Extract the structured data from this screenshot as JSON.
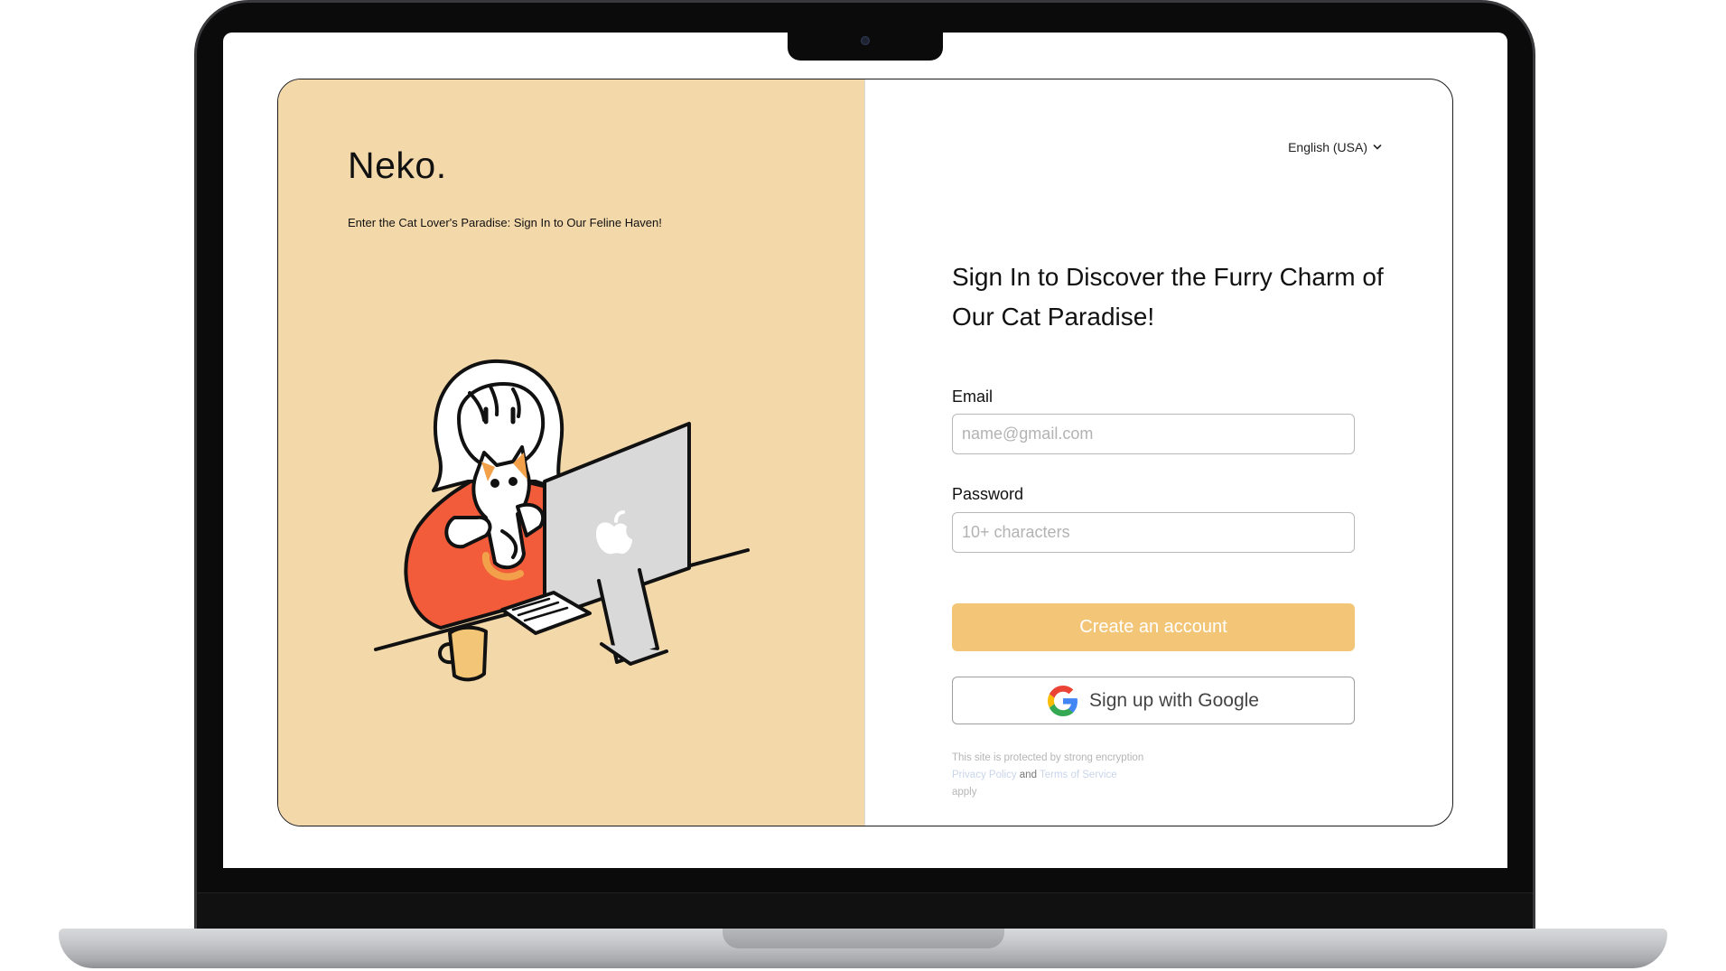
{
  "app": {
    "brand": "Neko.",
    "tagline": "Enter the Cat Lover's Paradise: Sign In to Our Feline Haven!",
    "language_selector": "English (USA)"
  },
  "form": {
    "headline": "Sign In to Discover the Furry Charm of Our Cat Paradise!",
    "email_label": "Email",
    "email_placeholder": "name@gmail.com",
    "password_label": "Password",
    "password_placeholder": "10+ characters",
    "create_button": "Create an account",
    "google_button": "Sign up with Google"
  },
  "footnote": {
    "line1": "This site is protected by strong encryption",
    "privacy_link": "Privacy Policy",
    "and_text": "and",
    "terms_link": "Terms of Service",
    "apply_text": "apply"
  },
  "colors": {
    "left_panel_bg": "#f3d8aa",
    "primary_button_bg": "#f3c577",
    "sweater": "#f25c3a"
  },
  "icons": [
    "chevron-down-icon",
    "google-icon",
    "apple-logo-icon"
  ]
}
